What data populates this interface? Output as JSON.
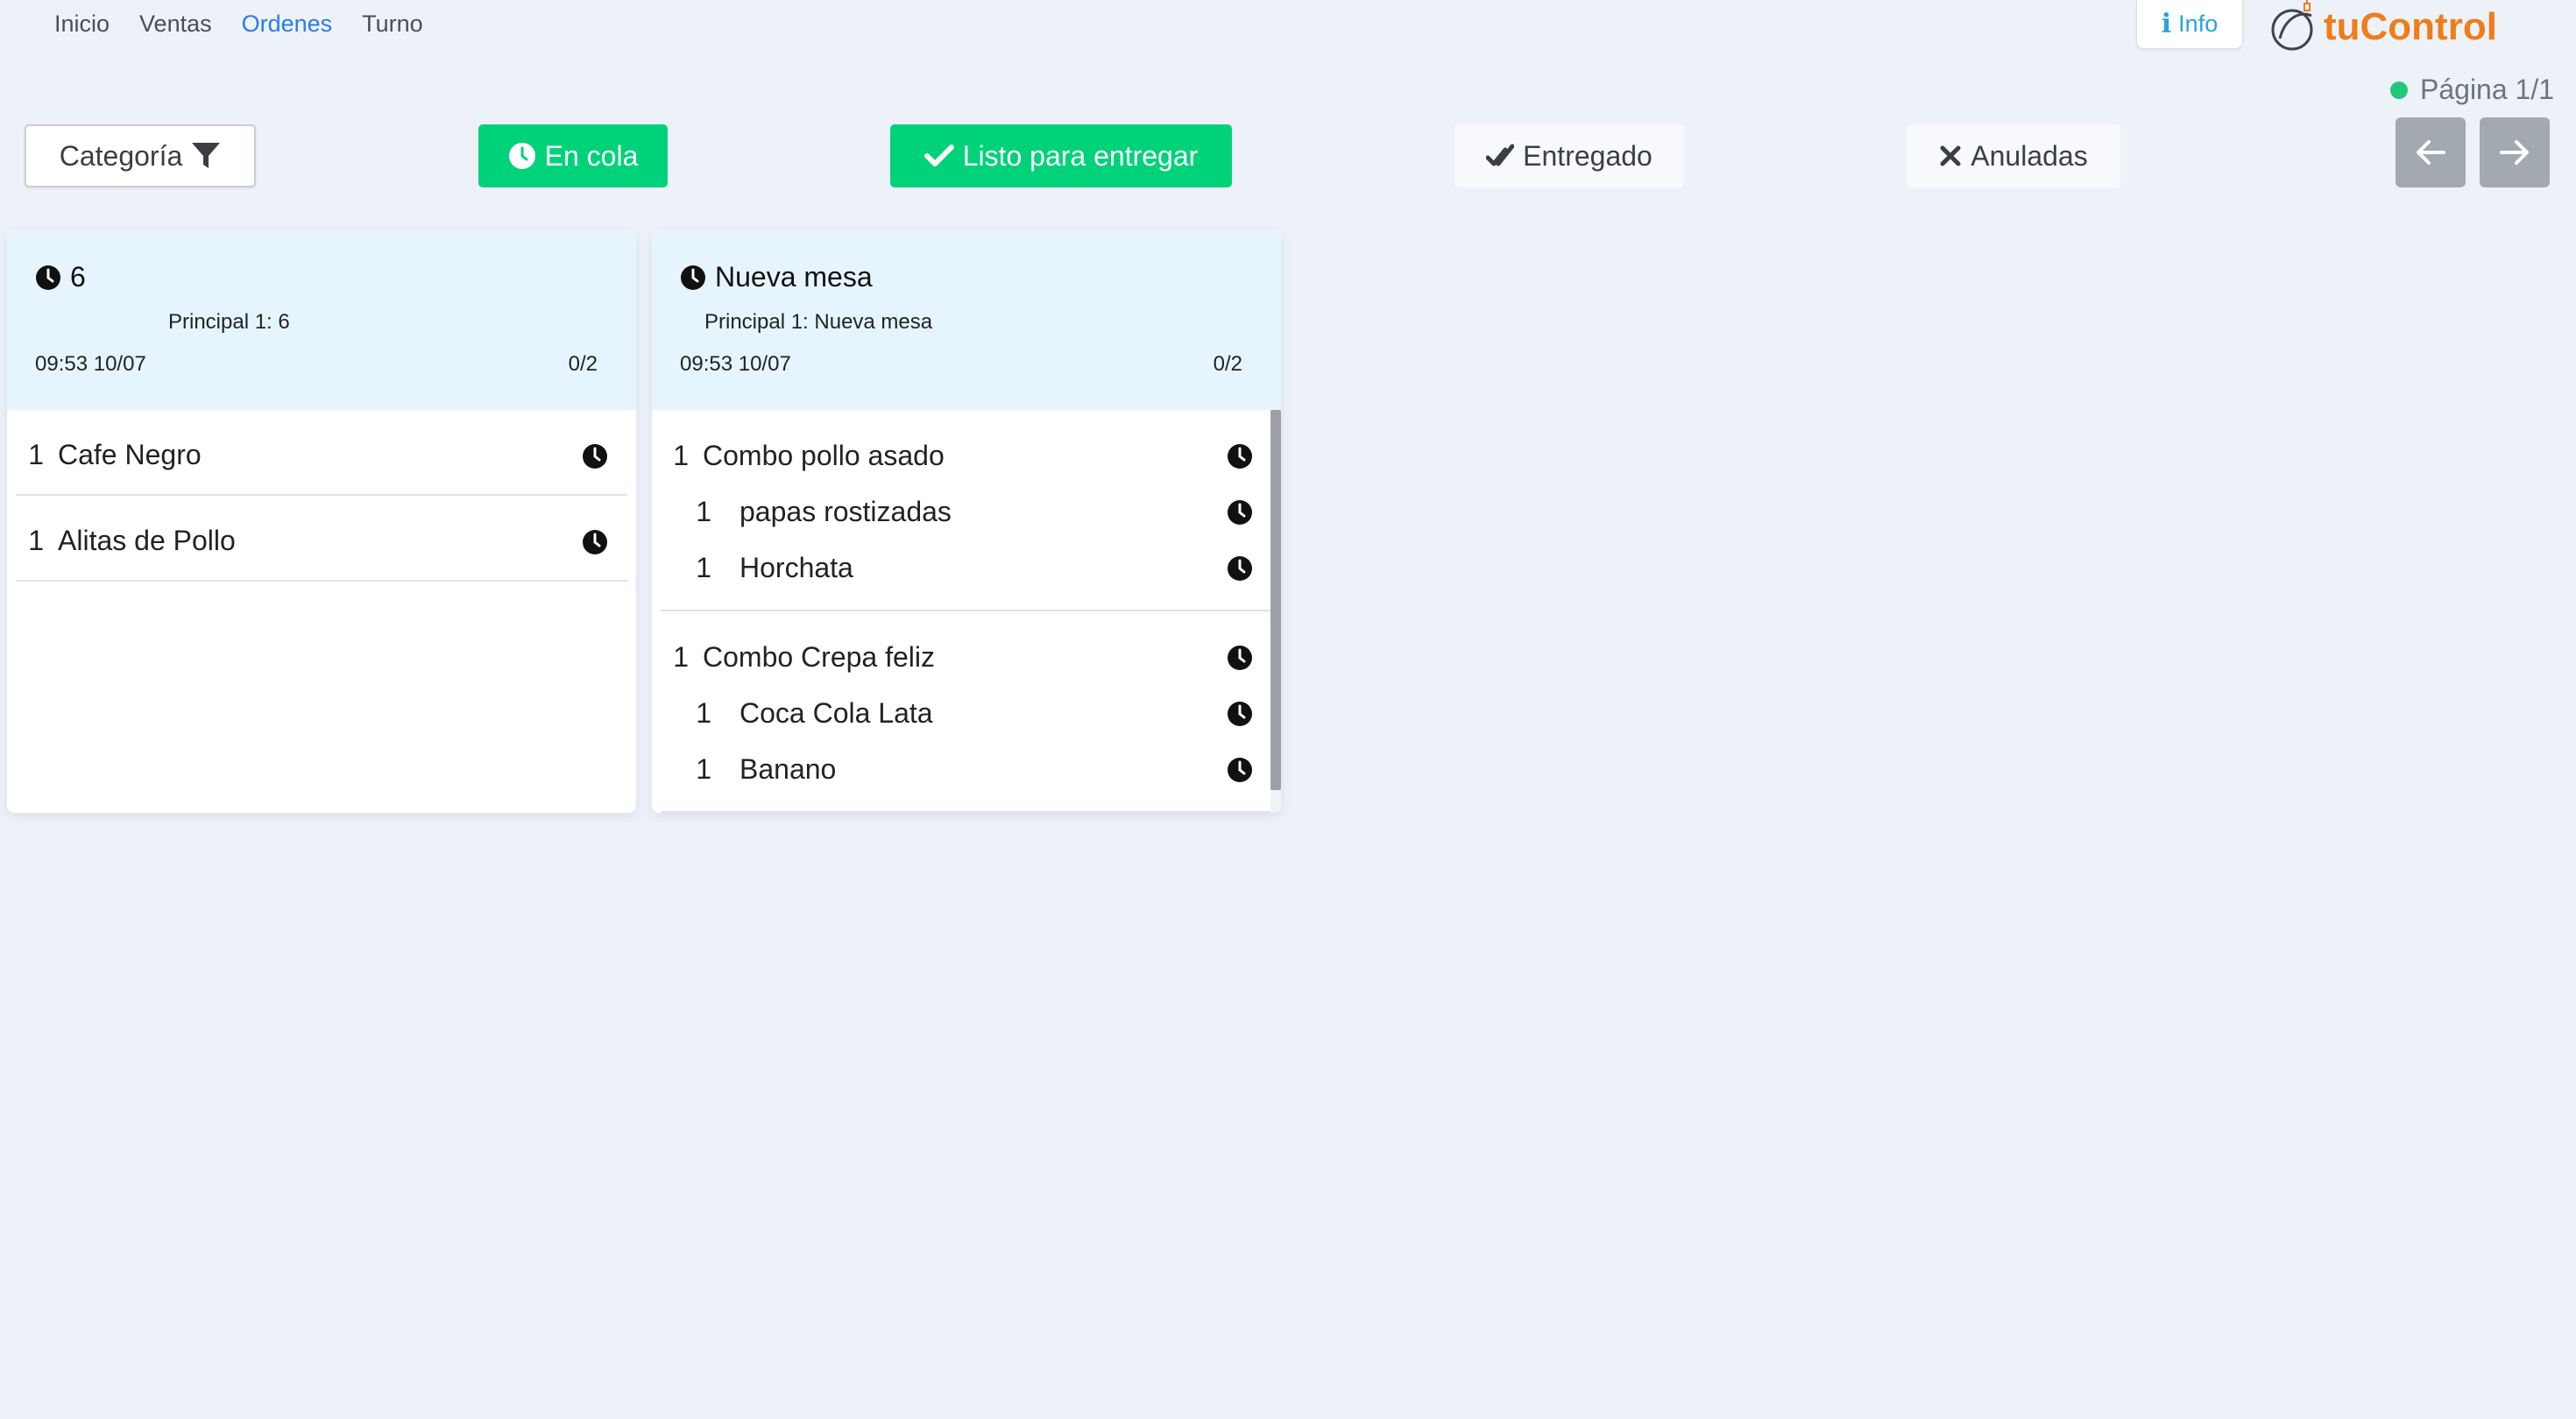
{
  "nav": {
    "items": [
      {
        "label": "Inicio",
        "active": false
      },
      {
        "label": "Ventas",
        "active": false
      },
      {
        "label": "Ordenes",
        "active": true
      },
      {
        "label": "Turno",
        "active": false
      }
    ],
    "active_color": "#2c7be5"
  },
  "header": {
    "info_label": "Info",
    "info_icon": "info-icon",
    "logo_text": "tuControl",
    "logo_color": "#ee7d1a",
    "status_color": "#20c978",
    "page_label": "Página 1/1",
    "prev_icon": "arrow-left-icon",
    "next_icon": "arrow-right-icon"
  },
  "toolbar": {
    "category_label": "Categoría",
    "category_icon": "filter-icon",
    "queue_label": "En cola",
    "queue_icon": "clock-icon",
    "ready_label": "Listo para entregar",
    "ready_icon": "check-icon",
    "delivered_label": "Entregado",
    "delivered_icon": "double-check-icon",
    "voided_label": "Anuladas",
    "voided_icon": "close-icon",
    "accent_color": "#00d27a"
  },
  "orders": [
    {
      "title": "6",
      "subtitle": "Principal 1: 6",
      "time": "09:53 10/07",
      "progress": "0/2",
      "groups": [
        {
          "qty": "1",
          "name": "Cafe Negro",
          "subitems": []
        },
        {
          "qty": "1",
          "name": "Alitas de Pollo",
          "subitems": []
        }
      ]
    },
    {
      "title": "Nueva mesa",
      "subtitle": "Principal 1: Nueva mesa",
      "time": "09:53 10/07",
      "progress": "0/2",
      "groups": [
        {
          "qty": "1",
          "name": "Combo pollo asado",
          "subitems": [
            {
              "qty": "1",
              "name": "papas rostizadas"
            },
            {
              "qty": "1",
              "name": "Horchata"
            }
          ]
        },
        {
          "qty": "1",
          "name": "Combo Crepa feliz",
          "subitems": [
            {
              "qty": "1",
              "name": "Coca Cola Lata"
            },
            {
              "qty": "1",
              "name": "Banano"
            }
          ]
        }
      ]
    }
  ]
}
